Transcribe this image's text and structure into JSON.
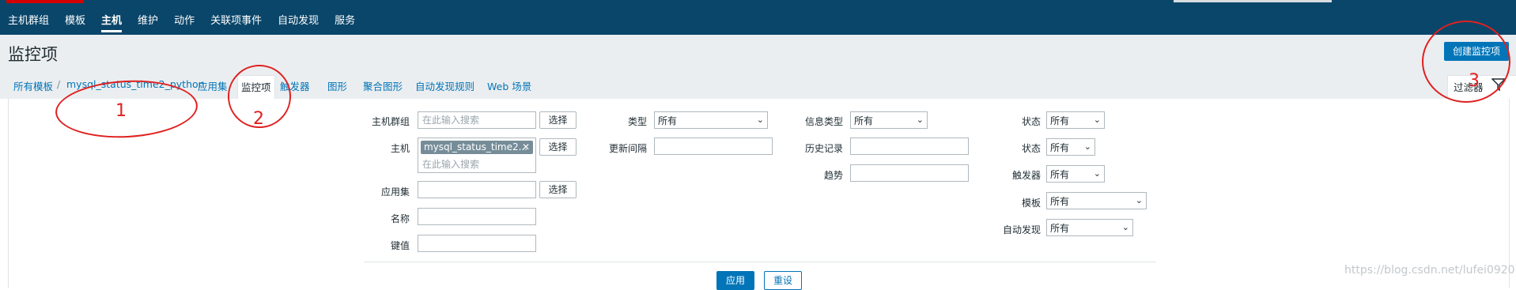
{
  "topnav": {
    "items": [
      {
        "label": "主机群组",
        "active": false
      },
      {
        "label": "模板",
        "active": false
      },
      {
        "label": "主机",
        "active": true
      },
      {
        "label": "维护",
        "active": false
      },
      {
        "label": "动作",
        "active": false
      },
      {
        "label": "关联项事件",
        "active": false
      },
      {
        "label": "自动发现",
        "active": false
      },
      {
        "label": "服务",
        "active": false
      }
    ]
  },
  "page": {
    "title": "监控项",
    "create_button": "创建监控项"
  },
  "breadcrumbs": {
    "all_templates": "所有模板",
    "separator": "/",
    "template_name": "mysql_status_time2_python",
    "tabs": [
      "应用集",
      "监控项",
      "触发器",
      "图形",
      "聚合图形",
      "自动发现规则",
      "Web 场景"
    ],
    "selected_tab": "监控项"
  },
  "filter": {
    "toggle_label": "过滤器",
    "select_button": "选择",
    "col1": {
      "host_group_label": "主机群组",
      "host_label": "主机",
      "application_label": "应用集",
      "name_label": "名称",
      "key_label": "键值",
      "search_placeholder": "在此输入搜索",
      "host_chip": "mysql_status_time2..."
    },
    "col2": {
      "type_label": "类型",
      "type_value": "所有",
      "interval_label": "更新间隔"
    },
    "col3": {
      "info_type_label": "信息类型",
      "info_type_value": "所有",
      "history_label": "历史记录",
      "trends_label": "趋势"
    },
    "col4": {
      "state_label": "状态",
      "state_value": "所有",
      "status_label": "状态",
      "status_value": "所有",
      "triggers_label": "触发器",
      "triggers_value": "所有",
      "template_label": "模板",
      "template_value": "所有",
      "discovery_label": "自动发现",
      "discovery_value": "所有"
    },
    "apply_button": "应用",
    "reset_button": "重设"
  },
  "annotations": [
    "1",
    "2",
    "3"
  ],
  "watermark": "https://blog.csdn.net/lufei0920",
  "colors": {
    "topbar": "#0a466a",
    "accent": "#0275b8",
    "annotation": "#e02020"
  }
}
